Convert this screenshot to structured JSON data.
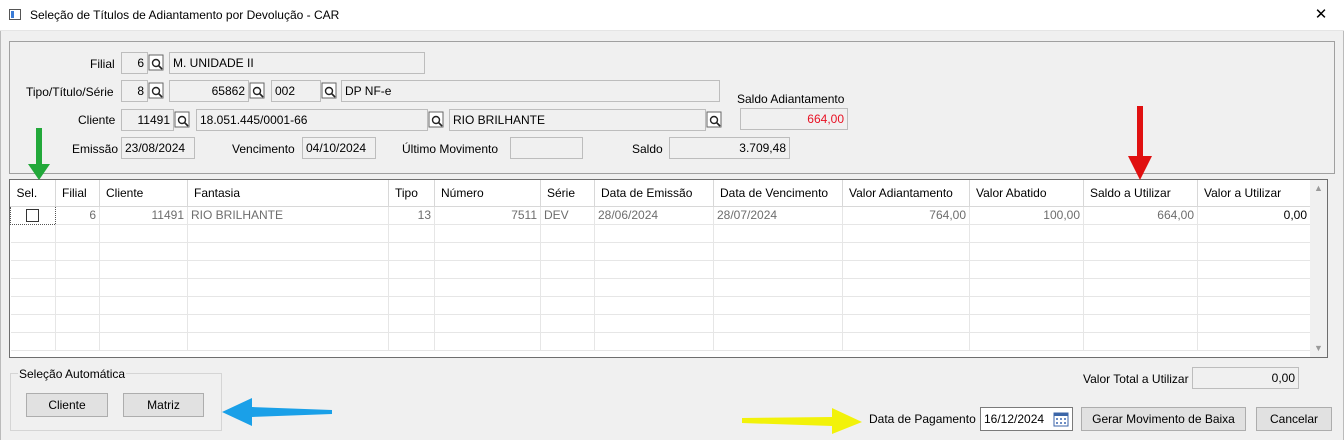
{
  "window": {
    "title": "Seleção de Títulos de Adiantamento por Devolução - CAR",
    "close_symbol": "✕"
  },
  "header": {
    "filial_label": "Filial",
    "filial_code": "6",
    "filial_name": "M. UNIDADE II",
    "tipo_label": "Tipo/Título/Série",
    "tipo_value": "8",
    "titulo_value": "65862",
    "serie_value": "002",
    "serie_desc": "DP NF-e",
    "saldo_adiantamento_label": "Saldo Adiantamento",
    "saldo_adiantamento_value": "664,00",
    "cliente_label": "Cliente",
    "cliente_code": "11491",
    "cliente_cnpj": "18.051.445/0001-66",
    "cliente_name": "RIO BRILHANTE",
    "emissao_label": "Emissão",
    "emissao_value": "23/08/2024",
    "vencimento_label": "Vencimento",
    "vencimento_value": "04/10/2024",
    "ultimo_mov_label": "Último Movimento",
    "ultimo_mov_value": "",
    "saldo_label": "Saldo",
    "saldo_value": "3.709,48"
  },
  "grid": {
    "columns": [
      "Sel.",
      "Filial",
      "Cliente",
      "Fantasia",
      "Tipo",
      "Número",
      "Série",
      "Data de Emissão",
      "Data de Vencimento",
      "Valor Adiantamento",
      "Valor Abatido",
      "Saldo a Utilizar",
      "Valor a Utilizar"
    ],
    "rows": [
      {
        "sel": false,
        "filial": "6",
        "cliente": "11491",
        "fantasia": "RIO BRILHANTE",
        "tipo": "13",
        "numero": "7511",
        "serie": "DEV",
        "emissao": "28/06/2024",
        "vencimento": "28/07/2024",
        "valor_adiantamento": "764,00",
        "valor_abatido": "100,00",
        "saldo_utilizar": "664,00",
        "valor_utilizar": "0,00"
      }
    ]
  },
  "auto_selection": {
    "legend": "Seleção Automática",
    "cliente_button": "Cliente",
    "matriz_button": "Matriz"
  },
  "footer": {
    "valor_total_label": "Valor Total a Utilizar",
    "valor_total_value": "0,00",
    "data_pagamento_label": "Data de Pagamento",
    "data_pagamento_value": "16/12/2024",
    "gerar_button": "Gerar Movimento de Baixa",
    "cancelar_button": "Cancelar"
  },
  "colors": {
    "accent_red": "#e81123",
    "arrow_green": "#22a83a",
    "arrow_red": "#e01010",
    "arrow_blue": "#1aa0e8",
    "arrow_yellow": "#f2f20a"
  }
}
